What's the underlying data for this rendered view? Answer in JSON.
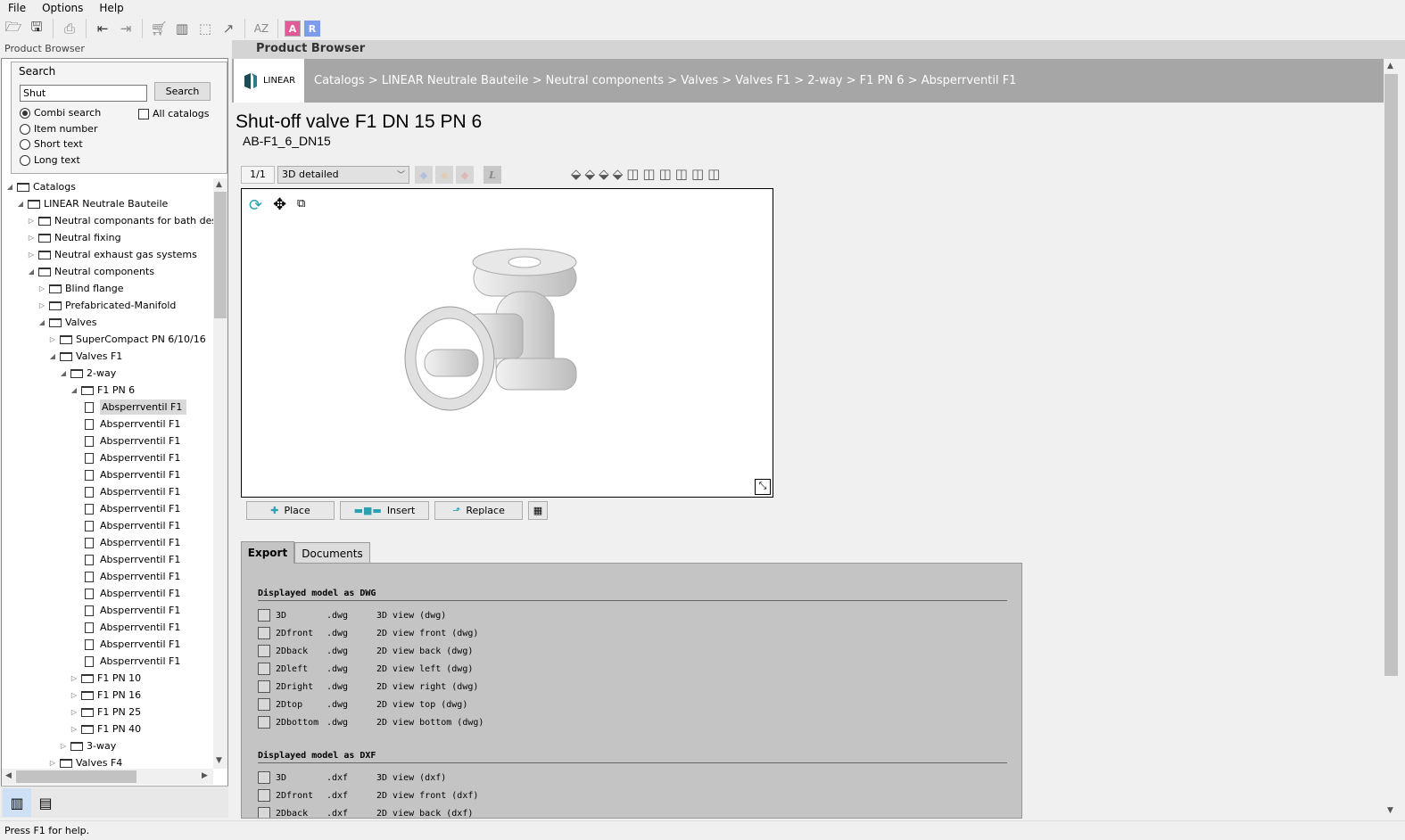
{
  "menu": [
    "File",
    "Options",
    "Help"
  ],
  "toolbar": {
    "icons": [
      "open-folder-icon",
      "save-icon",
      "print-icon",
      "import-icon",
      "export-icon",
      "cart-icon",
      "library-icon",
      "select-region-icon",
      "external-link-icon",
      "sort-az-icon"
    ],
    "a_label": "A",
    "r_label": "R",
    "a_color": "#e05c98",
    "r_color": "#7d9cf0"
  },
  "left": {
    "panel_title": "Product Browser",
    "search": {
      "title": "Search",
      "value": "Shut",
      "button": "Search",
      "modes": [
        "Combi search",
        "Item number",
        "Short text",
        "Long text"
      ],
      "selected_mode": "Combi search",
      "all_catalogs": "All catalogs",
      "all_catalogs_checked": false
    }
  },
  "tree": [
    {
      "label": "Catalogs",
      "level": 0,
      "expanded": true
    },
    {
      "label": "LINEAR Neutrale Bauteile",
      "level": 1,
      "expanded": true
    },
    {
      "label": "Neutral componants for bath desi",
      "level": 2,
      "expanded": false
    },
    {
      "label": "Neutral fixing",
      "level": 2,
      "expanded": false
    },
    {
      "label": "Neutral exhaust gas systems",
      "level": 2,
      "expanded": false
    },
    {
      "label": "Neutral components",
      "level": 2,
      "expanded": true
    },
    {
      "label": "Blind flange",
      "level": 3,
      "expanded": false
    },
    {
      "label": "Prefabricated-Manifold",
      "level": 3,
      "expanded": false
    },
    {
      "label": "Valves",
      "level": 3,
      "expanded": true
    },
    {
      "label": "SuperCompact PN  6/10/16",
      "level": 4,
      "expanded": false
    },
    {
      "label": "Valves F1",
      "level": 4,
      "expanded": true
    },
    {
      "label": "2-way",
      "level": 5,
      "expanded": true
    },
    {
      "label": "F1 PN 6",
      "level": 6,
      "expanded": true
    },
    {
      "label": "Absperrventil F1",
      "level": 7,
      "leaf": true,
      "selected": true
    },
    {
      "label": "Absperrventil F1",
      "level": 7,
      "leaf": true
    },
    {
      "label": "Absperrventil F1",
      "level": 7,
      "leaf": true
    },
    {
      "label": "Absperrventil F1",
      "level": 7,
      "leaf": true
    },
    {
      "label": "Absperrventil F1",
      "level": 7,
      "leaf": true
    },
    {
      "label": "Absperrventil F1",
      "level": 7,
      "leaf": true
    },
    {
      "label": "Absperrventil F1",
      "level": 7,
      "leaf": true
    },
    {
      "label": "Absperrventil F1",
      "level": 7,
      "leaf": true
    },
    {
      "label": "Absperrventil F1",
      "level": 7,
      "leaf": true
    },
    {
      "label": "Absperrventil F1",
      "level": 7,
      "leaf": true
    },
    {
      "label": "Absperrventil F1",
      "level": 7,
      "leaf": true
    },
    {
      "label": "Absperrventil F1",
      "level": 7,
      "leaf": true
    },
    {
      "label": "Absperrventil F1",
      "level": 7,
      "leaf": true
    },
    {
      "label": "Absperrventil F1",
      "level": 7,
      "leaf": true
    },
    {
      "label": "Absperrventil F1",
      "level": 7,
      "leaf": true
    },
    {
      "label": "Absperrventil F1",
      "level": 7,
      "leaf": true
    },
    {
      "label": "F1 PN 10",
      "level": 6,
      "expanded": false
    },
    {
      "label": "F1 PN 16",
      "level": 6,
      "expanded": false
    },
    {
      "label": "F1 PN 25",
      "level": 6,
      "expanded": false
    },
    {
      "label": "F1 PN 40",
      "level": 6,
      "expanded": false
    },
    {
      "label": "3-way",
      "level": 5,
      "expanded": false
    },
    {
      "label": "Valves F4",
      "level": 4,
      "expanded": false
    }
  ],
  "right": {
    "header": "Product Browser",
    "logo_text": "LINEAR",
    "breadcrumb": "Catalogs > LINEAR Neutrale Bauteile > Neutral components > Valves > Valves F1 > 2-way > F1 PN 6 > Absperrventil F1",
    "title": "Shut-off valve F1 DN  15  PN 6",
    "code": "AB-F1_6_DN15",
    "page": "1/1",
    "view_mode": "3D detailed",
    "buttons": {
      "place": "Place",
      "insert": "Insert",
      "replace": "Replace"
    },
    "tabs": [
      "Export",
      "Documents"
    ],
    "active_tab": "Export",
    "export": [
      {
        "title": "Displayed model as DWG",
        "rows": [
          [
            "3D",
            ".dwg",
            "3D view (dwg)"
          ],
          [
            "2Dfront",
            ".dwg",
            "2D view front (dwg)"
          ],
          [
            "2Dback",
            ".dwg",
            "2D view back (dwg)"
          ],
          [
            "2Dleft",
            ".dwg",
            "2D view left (dwg)"
          ],
          [
            "2Dright",
            ".dwg",
            "2D view right (dwg)"
          ],
          [
            "2Dtop",
            ".dwg",
            "2D view top (dwg)"
          ],
          [
            "2Dbottom",
            ".dwg",
            "2D view bottom (dwg)"
          ]
        ]
      },
      {
        "title": "Displayed model as DXF",
        "rows": [
          [
            "3D",
            ".dxf",
            "3D view (dxf)"
          ],
          [
            "2Dfront",
            ".dxf",
            "2D view front (dxf)"
          ],
          [
            "2Dback",
            ".dxf",
            "2D view back (dxf)"
          ]
        ]
      }
    ]
  },
  "status": "Press F1 for help."
}
